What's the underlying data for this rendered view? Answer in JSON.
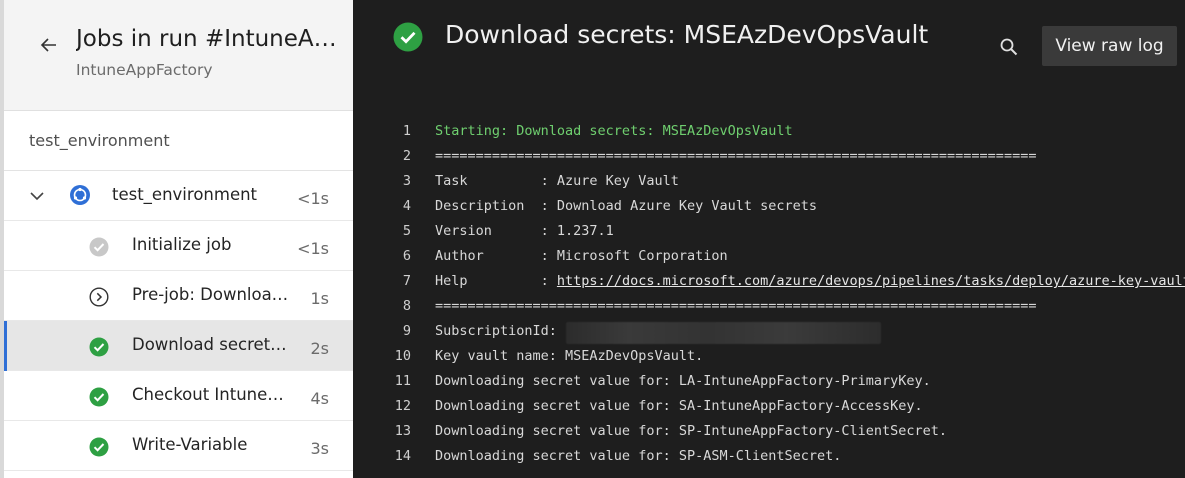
{
  "header": {
    "title": "Jobs in run #IntuneA…",
    "subtitle": "IntuneAppFactory"
  },
  "stage": {
    "label": "test_environment"
  },
  "job_group": {
    "name": "test_environment",
    "duration": "<1s",
    "expanded": true
  },
  "steps": [
    {
      "label": "Initialize job",
      "duration": "<1s",
      "status": "skipped"
    },
    {
      "label": "Pre-job: Downloa…",
      "duration": "1s",
      "status": "pending"
    },
    {
      "label": "Download secret…",
      "duration": "2s",
      "status": "success",
      "selected": true
    },
    {
      "label": "Checkout Intune…",
      "duration": "4s",
      "status": "success"
    },
    {
      "label": "Write-Variable",
      "duration": "3s",
      "status": "success"
    }
  ],
  "task": {
    "title": "Download secrets: MSEAzDevOpsVault",
    "view_raw_log_label": "View raw log",
    "status": "success"
  },
  "log": [
    {
      "n": "1",
      "text": "Starting: Download secrets: MSEAzDevOpsVault",
      "green": true
    },
    {
      "n": "2",
      "text": "=========================================================================="
    },
    {
      "n": "3",
      "text": "Task         : Azure Key Vault"
    },
    {
      "n": "4",
      "text": "Description  : Download Azure Key Vault secrets"
    },
    {
      "n": "5",
      "text": "Version      : 1.237.1"
    },
    {
      "n": "6",
      "text": "Author       : Microsoft Corporation"
    },
    {
      "n": "7",
      "prefix": "Help         : ",
      "link": "https://docs.microsoft.com/azure/devops/pipelines/tasks/deploy/azure-key-vault"
    },
    {
      "n": "8",
      "text": "=========================================================================="
    },
    {
      "n": "9",
      "text": "SubscriptionId:",
      "redacted": true
    },
    {
      "n": "10",
      "text": "Key vault name: MSEAzDevOpsVault."
    },
    {
      "n": "11",
      "text": "Downloading secret value for: LA-IntuneAppFactory-PrimaryKey."
    },
    {
      "n": "12",
      "text": "Downloading secret value for: SA-IntuneAppFactory-AccessKey."
    },
    {
      "n": "13",
      "text": "Downloading secret value for: SP-IntuneAppFactory-ClientSecret."
    },
    {
      "n": "14",
      "text": "Downloading secret value for: SP-ASM-ClientSecret."
    }
  ],
  "colors": {
    "success": "#2ea043",
    "accent": "#2f6fd6",
    "log_green": "#6fcf6f"
  },
  "icons": [
    "back-arrow-icon",
    "pipeline-job-icon",
    "check-circle-icon",
    "chevron-down-icon",
    "play-circle-icon",
    "search-icon"
  ]
}
